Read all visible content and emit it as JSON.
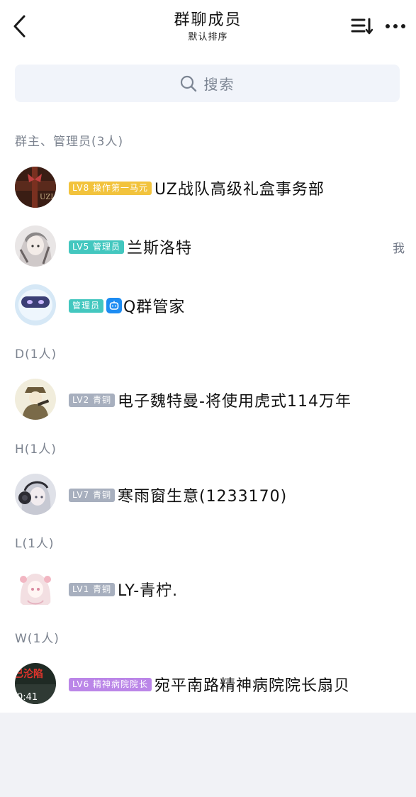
{
  "header": {
    "title": "群聊成员",
    "subtitle": "默认排序",
    "back_icon": "chevron-left-icon",
    "sort_icon": "sort-list-icon",
    "more_icon": "more-dots-icon"
  },
  "search": {
    "placeholder": "搜索",
    "icon": "search-icon"
  },
  "sections": [
    {
      "title": "群主、管理员(3人)",
      "members": [
        {
          "level_badge": "LV8 操作第一马元",
          "badge_color": "#f2c33d",
          "name": "UZ战队高级礼盒事务部",
          "tag": ""
        },
        {
          "level_badge": "LV5 管理员",
          "badge_color": "#43c7bf",
          "name": "兰斯洛特",
          "tag": "我"
        },
        {
          "level_badge": "管理员",
          "badge_color": "#43c7bf",
          "name": "Q群管家",
          "tag": "",
          "bot_icon": "robot-icon"
        }
      ]
    },
    {
      "title": "D(1人)",
      "members": [
        {
          "level_badge": "LV2 青铜",
          "badge_color": "#a7afbe",
          "name": "电子魏特曼-将使用虎式114万年"
        }
      ]
    },
    {
      "title": "H(1人)",
      "members": [
        {
          "level_badge": "LV7 青铜",
          "badge_color": "#a7afbe",
          "name": "寒雨窗生意(1233170)"
        }
      ]
    },
    {
      "title": "L(1人)",
      "members": [
        {
          "level_badge": "LV1 青铜",
          "badge_color": "#a7afbe",
          "name": "LY-青柠."
        }
      ]
    },
    {
      "title": "W(1人)",
      "members": [
        {
          "level_badge": "LV6 精神病院院长",
          "badge_color": "#bb86e8",
          "name": "宛平南路精神病院院长扇贝",
          "avatar_text": "已沦陷",
          "avatar_time": "0:41"
        }
      ]
    }
  ],
  "colors": {
    "accent_blue": "#1d8cf2",
    "section_text": "#7d8490",
    "background": "#f1f2f6"
  }
}
